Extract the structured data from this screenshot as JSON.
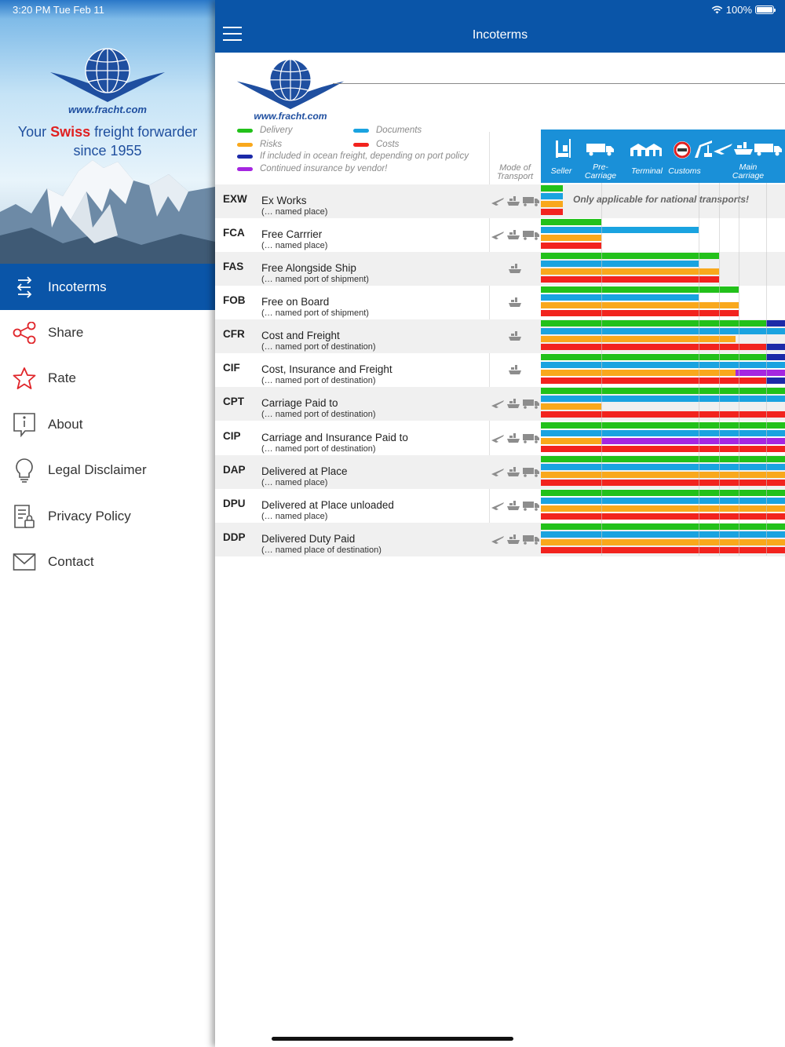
{
  "status": {
    "time": "3:20 PM   Tue Feb 11",
    "battery": "100%"
  },
  "brand": {
    "logo_text": "www.fracht.com"
  },
  "sidebar": {
    "tagline_pre": "Your ",
    "tagline_swiss": "Swiss",
    "tagline_post": " freight forwarder",
    "tagline_since": "since 1955",
    "items": [
      {
        "label": "Incoterms",
        "icon": "incoterms-icon",
        "active": true
      },
      {
        "label": "Share",
        "icon": "share-icon"
      },
      {
        "label": "Rate",
        "icon": "star-icon"
      },
      {
        "label": "About",
        "icon": "info-icon"
      },
      {
        "label": "Legal Disclaimer",
        "icon": "bulb-icon"
      },
      {
        "label": "Privacy Policy",
        "icon": "document-lock-icon"
      },
      {
        "label": "Contact",
        "icon": "mail-icon"
      }
    ]
  },
  "header": {
    "title": "Incoterms"
  },
  "legend": {
    "delivery": "Delivery",
    "documents": "Documents",
    "risks": "Risks",
    "costs": "Costs",
    "ocean": "If included in ocean freight, depending on port policy",
    "insurance": "Continued insurance by vendor!"
  },
  "colors": {
    "delivery": "#22c11a",
    "documents": "#1aa3e0",
    "risks": "#f9a81c",
    "costs": "#f2231e",
    "ocean": "#1c2aa8",
    "insurance": "#a526e0",
    "brand": "#0a55a8"
  },
  "table": {
    "mode_header_1": "Mode of",
    "mode_header_2": "Transport",
    "steps": {
      "seller": "Seller",
      "pre_1": "Pre-",
      "pre_2": "Carriage",
      "terminal": "Terminal",
      "customs": "Customs",
      "main_1": "Main",
      "main_2": "Carriage"
    },
    "note": "Only applicable for national transports!",
    "rows": [
      {
        "code": "EXW",
        "name": "Ex Works",
        "sub": "(… named place)",
        "modes": "all"
      },
      {
        "code": "FCA",
        "name": "Free Carrrier",
        "sub": "(… named place)",
        "modes": "all"
      },
      {
        "code": "FAS",
        "name": "Free Alongside Ship",
        "sub": "(… named port of shipment)",
        "modes": "sea"
      },
      {
        "code": "FOB",
        "name": "Free on Board",
        "sub": "(… named port of shipment)",
        "modes": "sea"
      },
      {
        "code": "CFR",
        "name": "Cost and Freight",
        "sub": "(… named port of destination)",
        "modes": "sea"
      },
      {
        "code": "CIF",
        "name": "Cost, Insurance and Freight",
        "sub": "(… named port of destination)",
        "modes": "sea"
      },
      {
        "code": "CPT",
        "name": "Carriage Paid to",
        "sub": "(… named port of destination)",
        "modes": "all"
      },
      {
        "code": "CIP",
        "name": "Carriage and Insurance Paid to",
        "sub": "(… named port of destination)",
        "modes": "all"
      },
      {
        "code": "DAP",
        "name": "Delivered at Place",
        "sub": "(… named place)",
        "modes": "all"
      },
      {
        "code": "DPU",
        "name": "Delivered at Place unloaded",
        "sub": "(… named place)",
        "modes": "all"
      },
      {
        "code": "DDP",
        "name": "Delivered Duty Paid",
        "sub": "(… named place of destination)",
        "modes": "all"
      }
    ]
  }
}
